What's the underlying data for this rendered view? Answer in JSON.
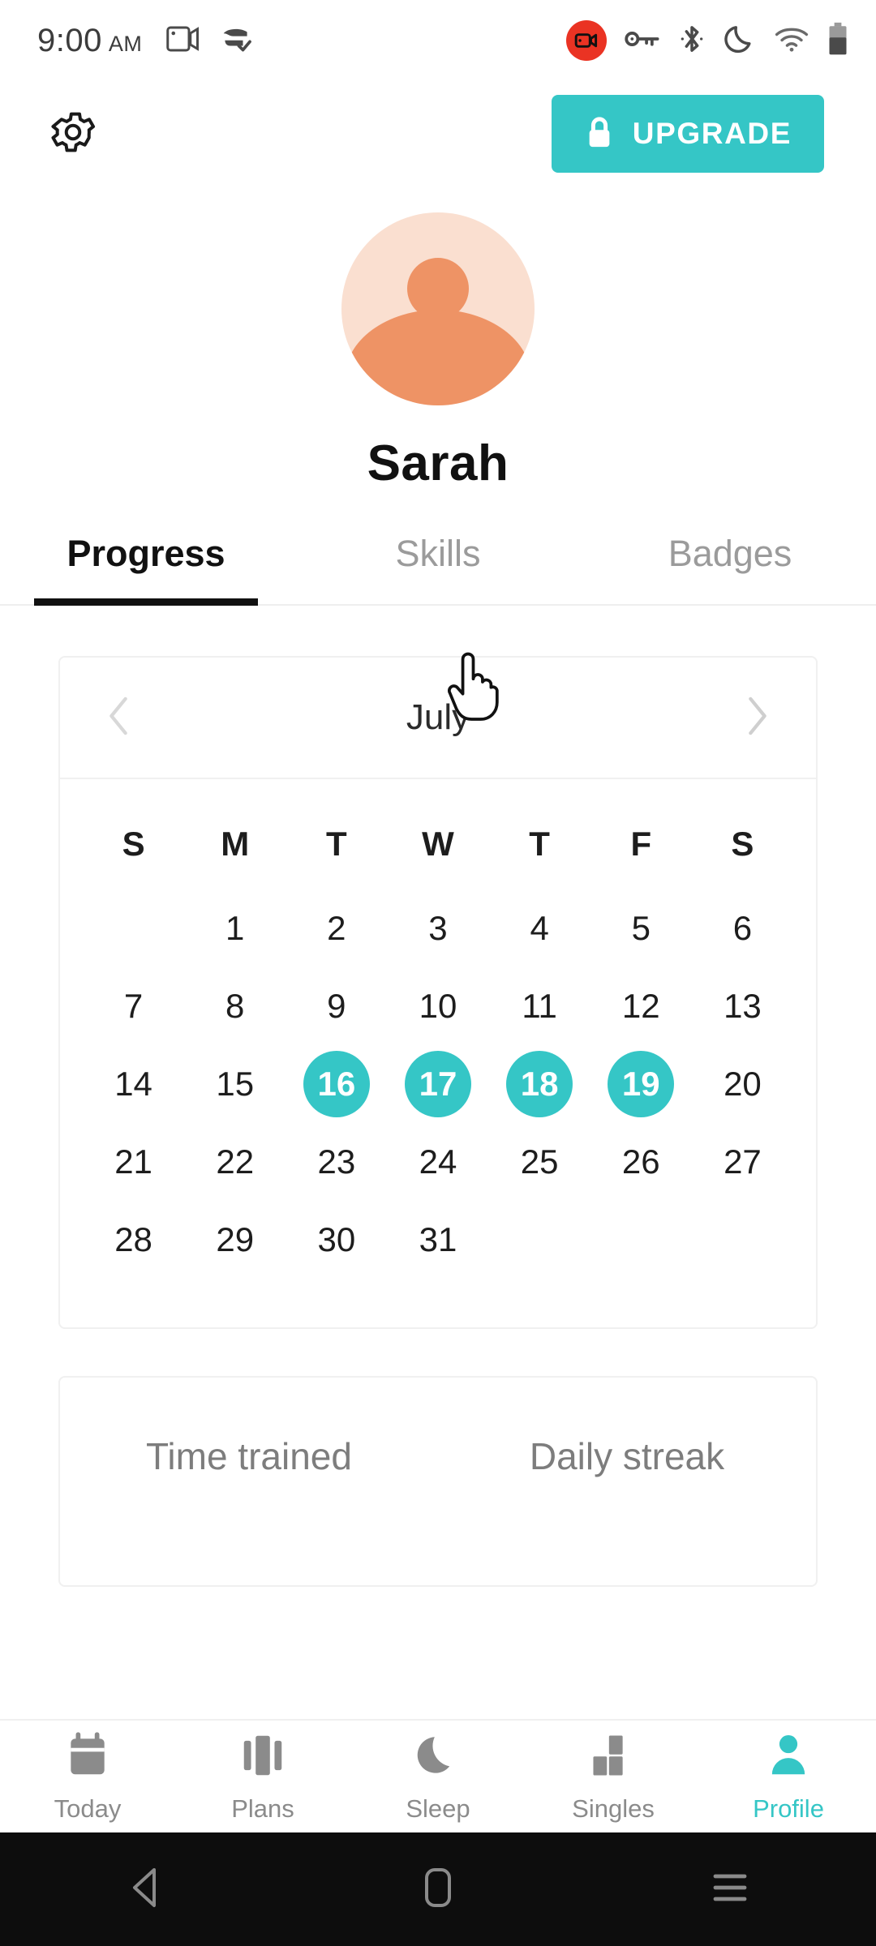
{
  "status_bar": {
    "time": "9:00",
    "ampm": "AM",
    "icons_left": [
      "screen-cast-icon",
      "data-saver-check-icon"
    ],
    "icons_right": [
      "screen-record-badge-icon",
      "vpn-key-icon",
      "bluetooth-icon",
      "do-not-disturb-moon-icon",
      "wifi-icon",
      "battery-icon"
    ]
  },
  "topbar": {
    "settings_icon": "gear-icon",
    "upgrade_label": "UPGRADE",
    "upgrade_icon": "lock-icon"
  },
  "profile": {
    "avatar_icon": "person-avatar",
    "name": "Sarah"
  },
  "tabs": [
    {
      "label": "Progress",
      "active": true
    },
    {
      "label": "Skills",
      "active": false
    },
    {
      "label": "Badges",
      "active": false
    }
  ],
  "calendar": {
    "month": "July",
    "prev_icon": "chevron-left-icon",
    "next_icon": "chevron-right-icon",
    "weekdays": [
      "S",
      "M",
      "T",
      "W",
      "T",
      "F",
      "S"
    ],
    "weeks": [
      [
        "",
        "1",
        "2",
        "3",
        "4",
        "5",
        "6"
      ],
      [
        "7",
        "8",
        "9",
        "10",
        "11",
        "12",
        "13"
      ],
      [
        "14",
        "15",
        "16",
        "17",
        "18",
        "19",
        "20"
      ],
      [
        "21",
        "22",
        "23",
        "24",
        "25",
        "26",
        "27"
      ],
      [
        "28",
        "29",
        "30",
        "31",
        "",
        "",
        ""
      ]
    ],
    "selected_days": [
      "16",
      "17",
      "18",
      "19"
    ],
    "selected_color": "#35c6c6"
  },
  "stats": [
    {
      "label": "Time trained"
    },
    {
      "label": "Daily streak"
    }
  ],
  "bottom_nav": [
    {
      "label": "Today",
      "icon": "calendar-icon",
      "active": false
    },
    {
      "label": "Plans",
      "icon": "bars-icon",
      "active": false
    },
    {
      "label": "Sleep",
      "icon": "moon-icon",
      "active": false
    },
    {
      "label": "Singles",
      "icon": "blocks-icon",
      "active": false
    },
    {
      "label": "Profile",
      "icon": "person-icon",
      "active": true
    }
  ],
  "android_nav": [
    {
      "icon": "back-triangle-icon"
    },
    {
      "icon": "home-square-icon"
    },
    {
      "icon": "recents-lines-icon"
    }
  ],
  "theme": {
    "accent": "#35c6c6",
    "avatar_bg": "#fadfd0",
    "avatar_fg": "#ee9365",
    "record_red": "#ea3323"
  }
}
